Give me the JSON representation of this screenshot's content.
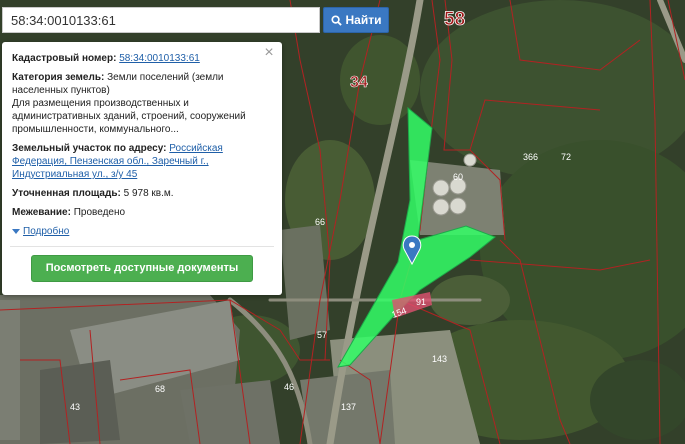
{
  "search": {
    "value": "58:34:0010133:61",
    "button_label": "Найти"
  },
  "info_panel": {
    "cadastral_label": "Кадастровый номер:",
    "cadastral_number": "58:34:0010133:61",
    "category_label": "Категория земель:",
    "category_value": "Земли поселений (земли населенных пунктов)",
    "purpose": "Для размещения производственных и административных зданий, строений, сооружений промышленности, коммунального...",
    "address_label": "Земельный участок по адресу:",
    "address_value": "Российская Федерация, Пензенская обл., Заречный г., Индустриальная ул., з/у 45",
    "area_label": "Уточненная площадь:",
    "area_value": "5 978 кв.м.",
    "survey_label": "Межевание:",
    "survey_value": "Проведено",
    "more_link": "Подробно",
    "docs_button": "Посмотреть доступные документы"
  },
  "map": {
    "block_labels": {
      "b58": "58",
      "b34": "34"
    },
    "parcel_labels": {
      "p60": "60",
      "p366": "366",
      "p72": "72",
      "p66": "66",
      "p57": "57",
      "p68": "68",
      "p46": "46",
      "p43": "43",
      "p137": "137",
      "p143": "143",
      "p154": "154",
      "p91": "91"
    },
    "colors": {
      "parcel_highlight": "#33ff66",
      "boundary": "#b22222",
      "block_label": "#a01818",
      "marker": "#3a78c2"
    }
  }
}
